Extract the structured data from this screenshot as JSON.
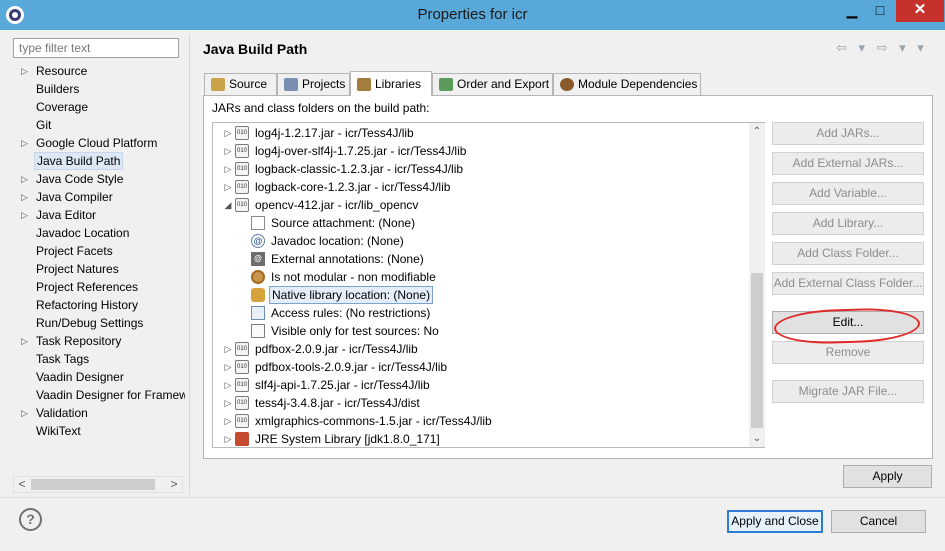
{
  "window": {
    "title": "Properties for icr",
    "minimize": "▁",
    "maximize": "□",
    "close": "✕"
  },
  "filter": {
    "placeholder": "type filter text"
  },
  "nav": {
    "items": [
      {
        "label": "Resource",
        "expandable": true
      },
      {
        "label": "Builders",
        "expandable": false
      },
      {
        "label": "Coverage",
        "expandable": false
      },
      {
        "label": "Git",
        "expandable": false
      },
      {
        "label": "Google Cloud Platform",
        "expandable": true
      },
      {
        "label": "Java Build Path",
        "expandable": false,
        "selected": true
      },
      {
        "label": "Java Code Style",
        "expandable": true
      },
      {
        "label": "Java Compiler",
        "expandable": true
      },
      {
        "label": "Java Editor",
        "expandable": true
      },
      {
        "label": "Javadoc Location",
        "expandable": false
      },
      {
        "label": "Project Facets",
        "expandable": false
      },
      {
        "label": "Project Natures",
        "expandable": false
      },
      {
        "label": "Project References",
        "expandable": false
      },
      {
        "label": "Refactoring History",
        "expandable": false
      },
      {
        "label": "Run/Debug Settings",
        "expandable": false
      },
      {
        "label": "Task Repository",
        "expandable": true
      },
      {
        "label": "Task Tags",
        "expandable": false
      },
      {
        "label": "Vaadin Designer",
        "expandable": false
      },
      {
        "label": "Vaadin Designer for Framew",
        "expandable": false
      },
      {
        "label": "Validation",
        "expandable": true
      },
      {
        "label": "WikiText",
        "expandable": false
      }
    ]
  },
  "page": {
    "title": "Java Build Path",
    "nav_arrows": "⇦ ▾ ⇨ ▾ ▾"
  },
  "tabs": [
    {
      "label": "Source",
      "icon": "source-folder-icon",
      "active": false
    },
    {
      "label": "Projects",
      "icon": "projects-icon",
      "active": false
    },
    {
      "label": "Libraries",
      "icon": "libraries-icon",
      "active": true
    },
    {
      "label": "Order and Export",
      "icon": "order-export-icon",
      "active": false
    },
    {
      "label": "Module Dependencies",
      "icon": "module-icon",
      "active": false
    }
  ],
  "libraries": {
    "heading": "JARs and class folders on the build path:",
    "rows": [
      {
        "label": "log4j-1.2.17.jar - icr/Tess4J/lib",
        "level": 0,
        "twisty": "▷",
        "icon": "jar-icon"
      },
      {
        "label": "log4j-over-slf4j-1.7.25.jar - icr/Tess4J/lib",
        "level": 0,
        "twisty": "▷",
        "icon": "jar-icon"
      },
      {
        "label": "logback-classic-1.2.3.jar - icr/Tess4J/lib",
        "level": 0,
        "twisty": "▷",
        "icon": "jar-icon"
      },
      {
        "label": "logback-core-1.2.3.jar - icr/Tess4J/lib",
        "level": 0,
        "twisty": "▷",
        "icon": "jar-icon"
      },
      {
        "label": "opencv-412.jar - icr/lib_opencv",
        "level": 0,
        "twisty": "◢",
        "icon": "jar-icon"
      },
      {
        "label": "Source attachment: (None)",
        "level": 1,
        "twisty": "",
        "icon": "source-attachment-icon"
      },
      {
        "label": "Javadoc location: (None)",
        "level": 1,
        "twisty": "",
        "icon": "javadoc-icon"
      },
      {
        "label": "External annotations: (None)",
        "level": 1,
        "twisty": "",
        "icon": "annotations-icon"
      },
      {
        "label": "Is not modular - non modifiable",
        "level": 1,
        "twisty": "",
        "icon": "module-icon"
      },
      {
        "label": "Native library location: (None)",
        "level": 1,
        "twisty": "",
        "icon": "native-library-icon",
        "selected": true
      },
      {
        "label": "Access rules: (No restrictions)",
        "level": 1,
        "twisty": "",
        "icon": "access-rules-icon"
      },
      {
        "label": "Visible only for test sources: No",
        "level": 1,
        "twisty": "",
        "icon": "test-visibility-icon"
      },
      {
        "label": "pdfbox-2.0.9.jar - icr/Tess4J/lib",
        "level": 0,
        "twisty": "▷",
        "icon": "jar-icon"
      },
      {
        "label": "pdfbox-tools-2.0.9.jar - icr/Tess4J/lib",
        "level": 0,
        "twisty": "▷",
        "icon": "jar-icon"
      },
      {
        "label": "slf4j-api-1.7.25.jar - icr/Tess4J/lib",
        "level": 0,
        "twisty": "▷",
        "icon": "jar-icon"
      },
      {
        "label": "tess4j-3.4.8.jar - icr/Tess4J/dist",
        "level": 0,
        "twisty": "▷",
        "icon": "jar-icon"
      },
      {
        "label": "xmlgraphics-commons-1.5.jar - icr/Tess4J/lib",
        "level": 0,
        "twisty": "▷",
        "icon": "jar-icon"
      },
      {
        "label": "JRE System Library [jdk1.8.0_171]",
        "level": 0,
        "twisty": "▷",
        "icon": "jre-library-icon"
      }
    ]
  },
  "side_buttons": [
    {
      "label": "Add JARs...",
      "enabled": false
    },
    {
      "label": "Add External JARs...",
      "enabled": false
    },
    {
      "label": "Add Variable...",
      "enabled": false
    },
    {
      "label": "Add Library...",
      "enabled": false
    },
    {
      "label": "Add Class Folder...",
      "enabled": false
    },
    {
      "label": "Add External Class Folder...",
      "enabled": false
    },
    {
      "label": "Edit...",
      "enabled": true
    },
    {
      "label": "Remove",
      "enabled": false
    },
    {
      "label": "Migrate JAR File...",
      "enabled": false
    }
  ],
  "buttons": {
    "apply": "Apply",
    "apply_close": "Apply and Close",
    "cancel": "Cancel"
  },
  "help": {
    "glyph": "?"
  },
  "scroll": {
    "left": "<",
    "right": ">",
    "up": "⌃",
    "down": "⌄"
  },
  "colors": {
    "titlebar": "#59a8da",
    "close": "#c7312b",
    "annotation": "#e12a2a",
    "selection": "#e4eefb"
  }
}
